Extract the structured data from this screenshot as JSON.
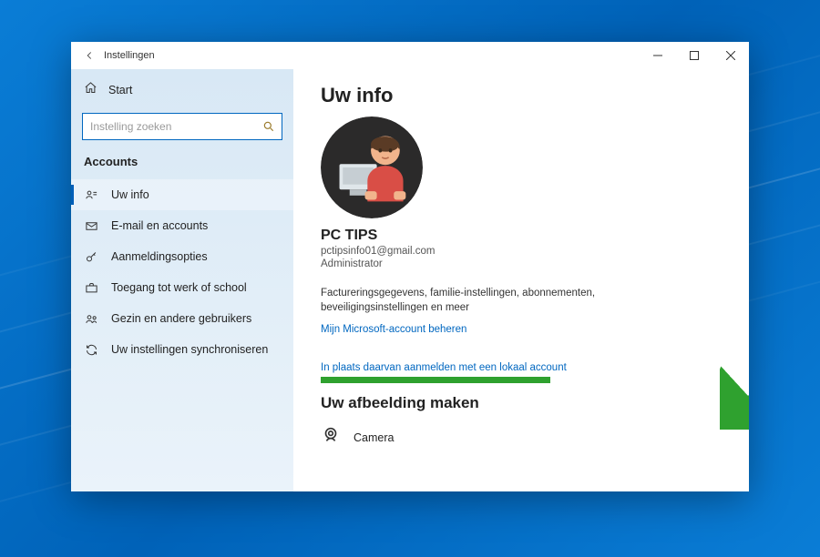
{
  "window": {
    "title": "Instellingen"
  },
  "sidebar": {
    "home": "Start",
    "search_placeholder": "Instelling zoeken",
    "category": "Accounts",
    "items": [
      {
        "label": "Uw info"
      },
      {
        "label": "E-mail en accounts"
      },
      {
        "label": "Aanmeldingsopties"
      },
      {
        "label": "Toegang tot werk of school"
      },
      {
        "label": "Gezin en andere gebruikers"
      },
      {
        "label": "Uw instellingen synchroniseren"
      }
    ]
  },
  "main": {
    "heading": "Uw info",
    "display_name": "PC TIPS",
    "email": "pctipsinfo01@gmail.com",
    "role": "Administrator",
    "description": "Factureringsgegevens, familie-instellingen, abonnementen, beveiligingsinstellingen en meer",
    "manage_link": "Mijn Microsoft-account beheren",
    "local_link": "In plaats daarvan aanmelden met een lokaal account",
    "picture_heading": "Uw afbeelding maken",
    "camera_label": "Camera"
  },
  "colors": {
    "accent": "#0067c0",
    "highlight": "#2fa12f"
  }
}
